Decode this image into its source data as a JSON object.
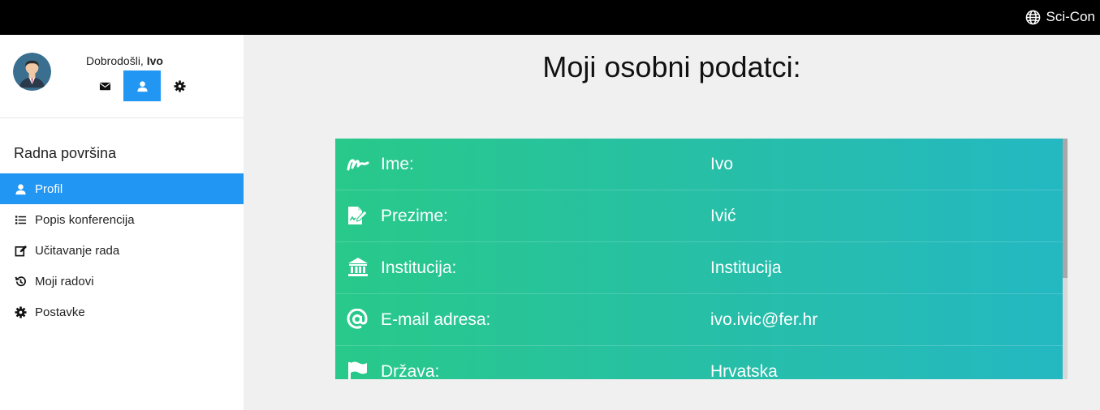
{
  "brand": {
    "name": "Sci-Con",
    "icon": "globe-icon"
  },
  "sidebar": {
    "welcome_text": "Dobrodošli, ",
    "user_name": "Ivo",
    "user_icons": [
      {
        "icon": "envelope-icon"
      },
      {
        "icon": "user-icon",
        "active": true
      },
      {
        "icon": "gear-icon"
      }
    ],
    "section_title": "Radna površina",
    "menu": [
      {
        "label": "Profil",
        "icon": "user-icon",
        "active": true
      },
      {
        "label": "Popis konferencija",
        "icon": "list-icon"
      },
      {
        "label": "Učitavanje rada",
        "icon": "edit-icon"
      },
      {
        "label": "Moji radovi",
        "icon": "history-icon"
      },
      {
        "label": "Postavke",
        "icon": "gear-icon"
      }
    ]
  },
  "main": {
    "title": "Moji osobni podatci:",
    "fields": [
      {
        "label": "Ime:",
        "value": "Ivo",
        "icon": "signature-icon"
      },
      {
        "label": "Prezime:",
        "value": "Ivić",
        "icon": "file-signature-icon"
      },
      {
        "label": "Institucija:",
        "value": "Institucija",
        "icon": "institution-icon"
      },
      {
        "label": "E-mail adresa:",
        "value": "ivo.ivic@fer.hr",
        "icon": "at-icon"
      },
      {
        "label": "Država:",
        "value": "Hrvatska",
        "icon": "flag-icon"
      }
    ]
  },
  "colors": {
    "accent": "#2196f3",
    "card_gradient_start": "#28c98a",
    "card_gradient_end": "#24b8c2",
    "topbar": "#000000"
  }
}
